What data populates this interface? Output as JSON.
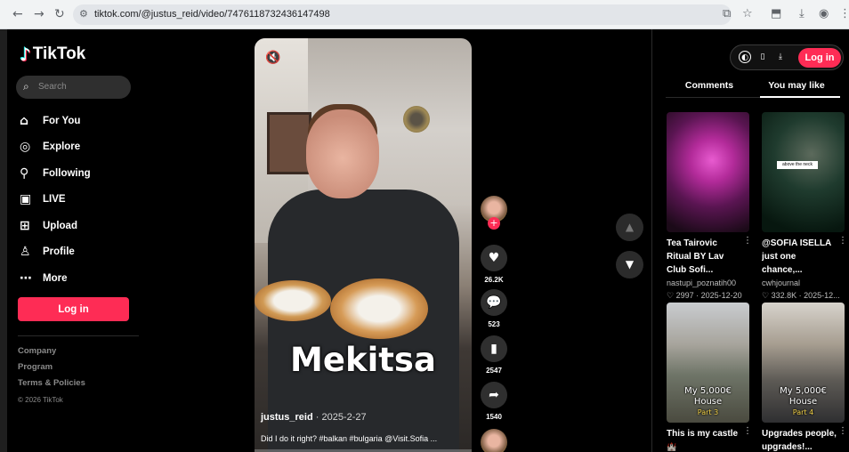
{
  "browser": {
    "url": "tiktok.com/@justus_reid/video/7476118732436147498",
    "nav_back": "←",
    "nav_forward": "→",
    "nav_reload": "↻",
    "right_icons": [
      "⧉",
      "☆",
      "⬒",
      "⤓",
      "◉",
      "⋮"
    ]
  },
  "sidebar": {
    "logo_text": "TikTok",
    "search_placeholder": "Search",
    "menu": [
      {
        "label": "For You",
        "icon": "home-icon"
      },
      {
        "label": "Explore",
        "icon": "compass-icon"
      },
      {
        "label": "Following",
        "icon": "following-icon"
      },
      {
        "label": "LIVE",
        "icon": "live-icon"
      },
      {
        "label": "Upload",
        "icon": "upload-icon"
      },
      {
        "label": "Profile",
        "icon": "profile-icon"
      },
      {
        "label": "More",
        "icon": "more-icon"
      }
    ],
    "login_label": "Log in",
    "footer": [
      "Company",
      "Program",
      "Terms & Policies"
    ],
    "copyright": "© 2026 TikTok"
  },
  "video": {
    "caption": "Mekitsa",
    "author": "justus_reid",
    "date": " · 2025-2-27",
    "description": "Did I do it right? #balkan #bulgaria @Visit.Sofia ...",
    "likes": "26.2K",
    "comments": "523",
    "saves": "2547",
    "shares": "1540"
  },
  "right_panel": {
    "login_label": "Log in",
    "tabs": {
      "comments": "Comments",
      "you_may_like": "You may like"
    },
    "cards": [
      {
        "title": "Tea Tairovic Ritual BY Lav Club Sofi...",
        "author": "nastupi_poznatih00",
        "stats": "♡ 2997 · 2025-12-20"
      },
      {
        "title": "@SOFIA ISELLA just one chance,...",
        "author": "cwhjournal",
        "stats": "♡ 332.8K · 2025-12...",
        "overlay": "above the neck"
      },
      {
        "title": "This is my castle",
        "author": "",
        "stats": "",
        "overlay1": "My 5,000€",
        "overlay2": "House",
        "overlay3": "Part 3",
        "emoji": "🏰"
      },
      {
        "title": "Upgrades people, upgrades!...",
        "author": "",
        "stats": "",
        "overlay1": "My 5,000€",
        "overlay2": "House",
        "overlay3": "Part 4"
      }
    ]
  },
  "colors": {
    "accent": "#fe2c55",
    "bg": "#000000",
    "panel": "#2f2f2f"
  }
}
